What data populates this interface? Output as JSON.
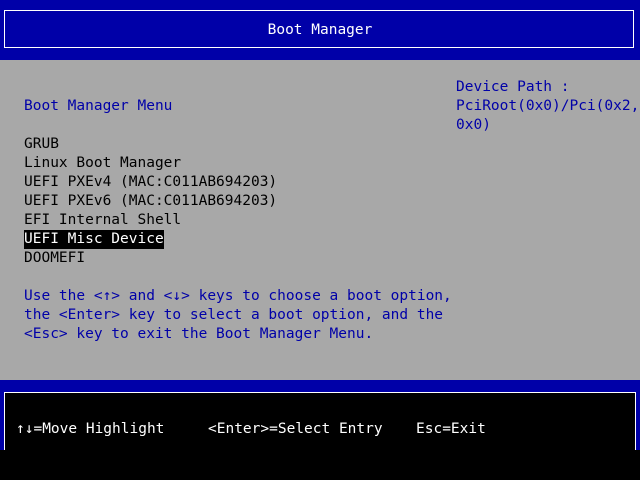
{
  "header": {
    "title": "Boot Manager"
  },
  "menu": {
    "title": "Boot Manager Menu",
    "device_path_label": "Device Path :",
    "device_path_value": "PciRoot(0x0)/Pci(0x2,0x0)",
    "items": [
      {
        "label": "GRUB",
        "selected": false
      },
      {
        "label": "Linux Boot Manager",
        "selected": false
      },
      {
        "label": "UEFI PXEv4 (MAC:C011AB694203)",
        "selected": false
      },
      {
        "label": "UEFI PXEv6 (MAC:C011AB694203)",
        "selected": false
      },
      {
        "label": "EFI Internal Shell",
        "selected": false
      },
      {
        "label": "UEFI Misc Device",
        "selected": true
      },
      {
        "label": "DOOMEFI",
        "selected": false
      }
    ],
    "help": [
      "Use the <↑> and <↓> keys to choose a boot option,",
      "the <Enter> key to select a boot option, and the",
      "<Esc> key to exit the Boot Manager Menu."
    ]
  },
  "footer": {
    "move": "↑↓=Move Highlight",
    "select": "<Enter>=Select Entry",
    "exit": "Esc=Exit"
  },
  "colors": {
    "background": "#a8a8a8",
    "header_blue": "#0000a8",
    "text_blue": "#0000a8",
    "highlight_bg": "#000000",
    "highlight_fg": "#ffffff"
  }
}
